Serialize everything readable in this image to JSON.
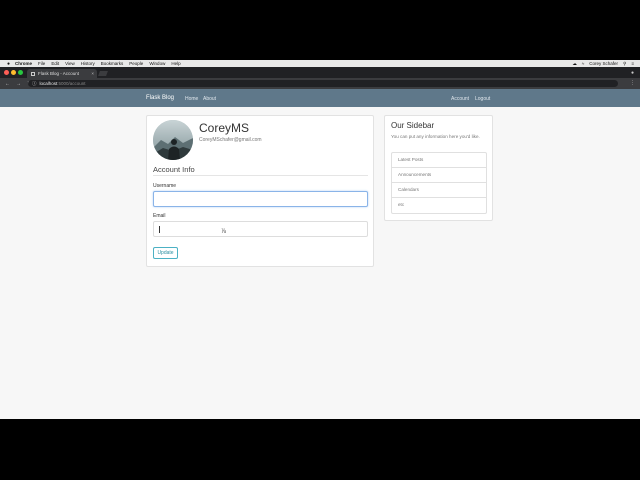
{
  "menubar": {
    "apple": "",
    "items": [
      "Chrome",
      "File",
      "Edit",
      "View",
      "History",
      "Bookmarks",
      "People",
      "Window",
      "Help"
    ],
    "user": "Corey Schafer"
  },
  "browser": {
    "tab_title": "Flask Blog - Account",
    "url_host": "localhost",
    "url_path": ":5000/account"
  },
  "navbar": {
    "brand": "Flask Blog",
    "home": "Home",
    "about": "About",
    "account": "Account",
    "logout": "Logout"
  },
  "profile": {
    "username": "CoreyMS",
    "email": "CoreyMSchafer@gmail.com"
  },
  "form": {
    "legend": "Account Info",
    "username_label": "Username",
    "username_value": "",
    "email_label": "Email",
    "email_value": "",
    "submit_label": "Update"
  },
  "sidebar": {
    "title": "Our Sidebar",
    "description": "You can put any information here you'd like.",
    "items": [
      {
        "label": "Latest Posts"
      },
      {
        "label": "Announcements"
      },
      {
        "label": "Calendars"
      },
      {
        "label": "etc"
      }
    ]
  },
  "colors": {
    "navbar": "#5f788a",
    "button_outline": "#4cb1c4"
  }
}
